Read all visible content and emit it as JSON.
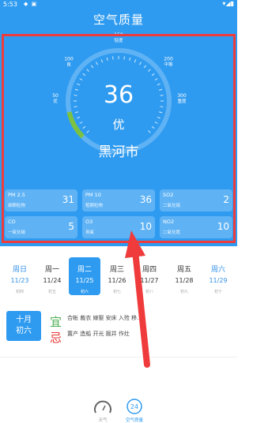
{
  "status_bar": {
    "time": "5:53"
  },
  "app": {
    "title": "空气质量"
  },
  "aqi": {
    "value": "36",
    "level": "优",
    "city": "黑河市",
    "gauge_fraction": 0.12,
    "ticks": [
      {
        "value": "50",
        "label": "优"
      },
      {
        "value": "100",
        "label": "良"
      },
      {
        "value": "150",
        "label": "轻度"
      },
      {
        "value": "200",
        "label": "中等"
      },
      {
        "value": "300",
        "label": "重度"
      }
    ]
  },
  "pollutants": [
    {
      "name": "PM 2.5",
      "desc": "细颗粒物",
      "value": "31"
    },
    {
      "name": "PM 10",
      "desc": "粗颗粒物",
      "value": "36"
    },
    {
      "name": "SO2",
      "desc": "二氧化硫",
      "value": "2"
    },
    {
      "name": "CO",
      "desc": "一氧化碳",
      "value": "5"
    },
    {
      "name": "O3",
      "desc": "臭氧",
      "value": "10"
    },
    {
      "name": "NO2",
      "desc": "二氧化氮",
      "value": "10"
    }
  ],
  "week": [
    {
      "name": "周日",
      "date": "11/23",
      "lunar": "初四"
    },
    {
      "name": "周一",
      "date": "11/24",
      "lunar": "初五"
    },
    {
      "name": "周二",
      "date": "11/25",
      "lunar": "初六"
    },
    {
      "name": "周三",
      "date": "11/26",
      "lunar": "初七"
    },
    {
      "name": "周四",
      "date": "11/27",
      "lunar": "初八"
    },
    {
      "name": "周五",
      "date": "11/28",
      "lunar": "初九"
    },
    {
      "name": "周六",
      "date": "11/29",
      "lunar": "初十"
    }
  ],
  "almanac": {
    "lunar_month": "十月",
    "lunar_day": "初六",
    "yi_label": "宜",
    "ji_label": "忌",
    "yi": "合帐 裁衣 嫁娶 安床 入殓 移...",
    "ji": "置产 造船 开光 掘井 作灶"
  },
  "tabs": [
    {
      "label": "天气"
    },
    {
      "label": "空气质量"
    }
  ],
  "colors": {
    "primary": "#2f9bf0",
    "card": "#5fb3f5",
    "highlight": "#ef3b3b",
    "good": "#7cc242"
  }
}
